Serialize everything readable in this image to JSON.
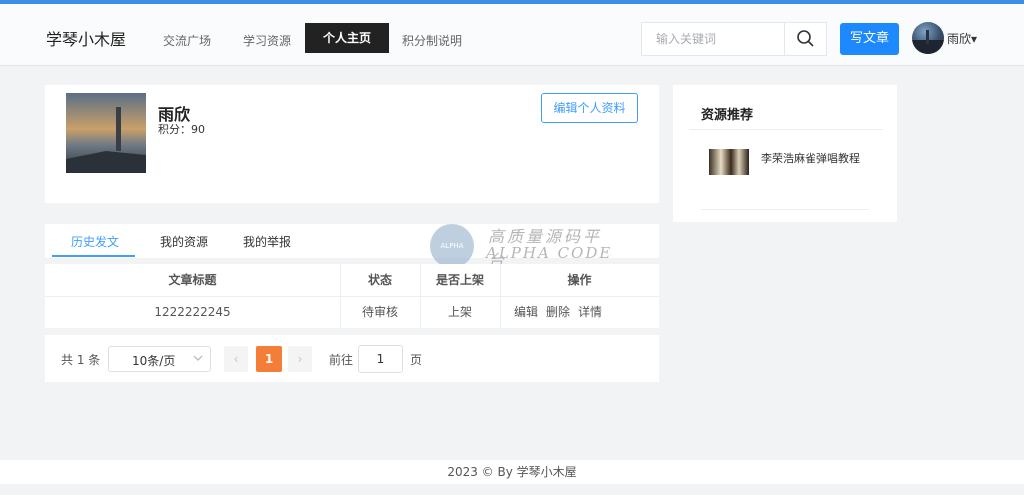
{
  "header": {
    "logo": "学琴小木屋",
    "nav": [
      {
        "label": "交流广场"
      },
      {
        "label": "学习资源"
      },
      {
        "label": "个人主页",
        "active": true
      },
      {
        "label": "积分制说明"
      }
    ],
    "search": {
      "placeholder": "输入关键词",
      "icon": "search-icon"
    },
    "write_label": "写文章",
    "user": {
      "name": "雨欣",
      "caret": "▾"
    }
  },
  "profile": {
    "name": "雨欣",
    "score": "积分：90",
    "edit_label": "编辑个人资料"
  },
  "tabs": [
    {
      "label": "历史发文",
      "active": true
    },
    {
      "label": "我的资源"
    },
    {
      "label": "我的举报"
    }
  ],
  "table": {
    "columns": [
      "文章标题",
      "状态",
      "是否上架",
      "操作"
    ],
    "rows": [
      {
        "title": "1222222245",
        "status": "待审核",
        "listed": "上架",
        "actions": [
          "编辑",
          "删除",
          "详情"
        ]
      }
    ]
  },
  "pagination": {
    "total": "共 1 条",
    "page_size": "10条/页",
    "prev": "‹",
    "current": "1",
    "next": "›",
    "goto_label": "前往",
    "goto_value": "1",
    "page_suffix": "页"
  },
  "sidebar": {
    "title": "资源推荐",
    "items": [
      {
        "title": "李荣浩麻雀弹唱教程"
      }
    ]
  },
  "watermark": {
    "badge": "ALPHA",
    "cn": "高质量源码平台",
    "en": "ALPHA CODE"
  },
  "footer": {
    "text": "2023 © By 学琴小木屋"
  },
  "colors": {
    "accent": "#409eff",
    "primary_button": "#1e88ff",
    "active_nav": "#222222",
    "current_page": "#f47e37"
  }
}
